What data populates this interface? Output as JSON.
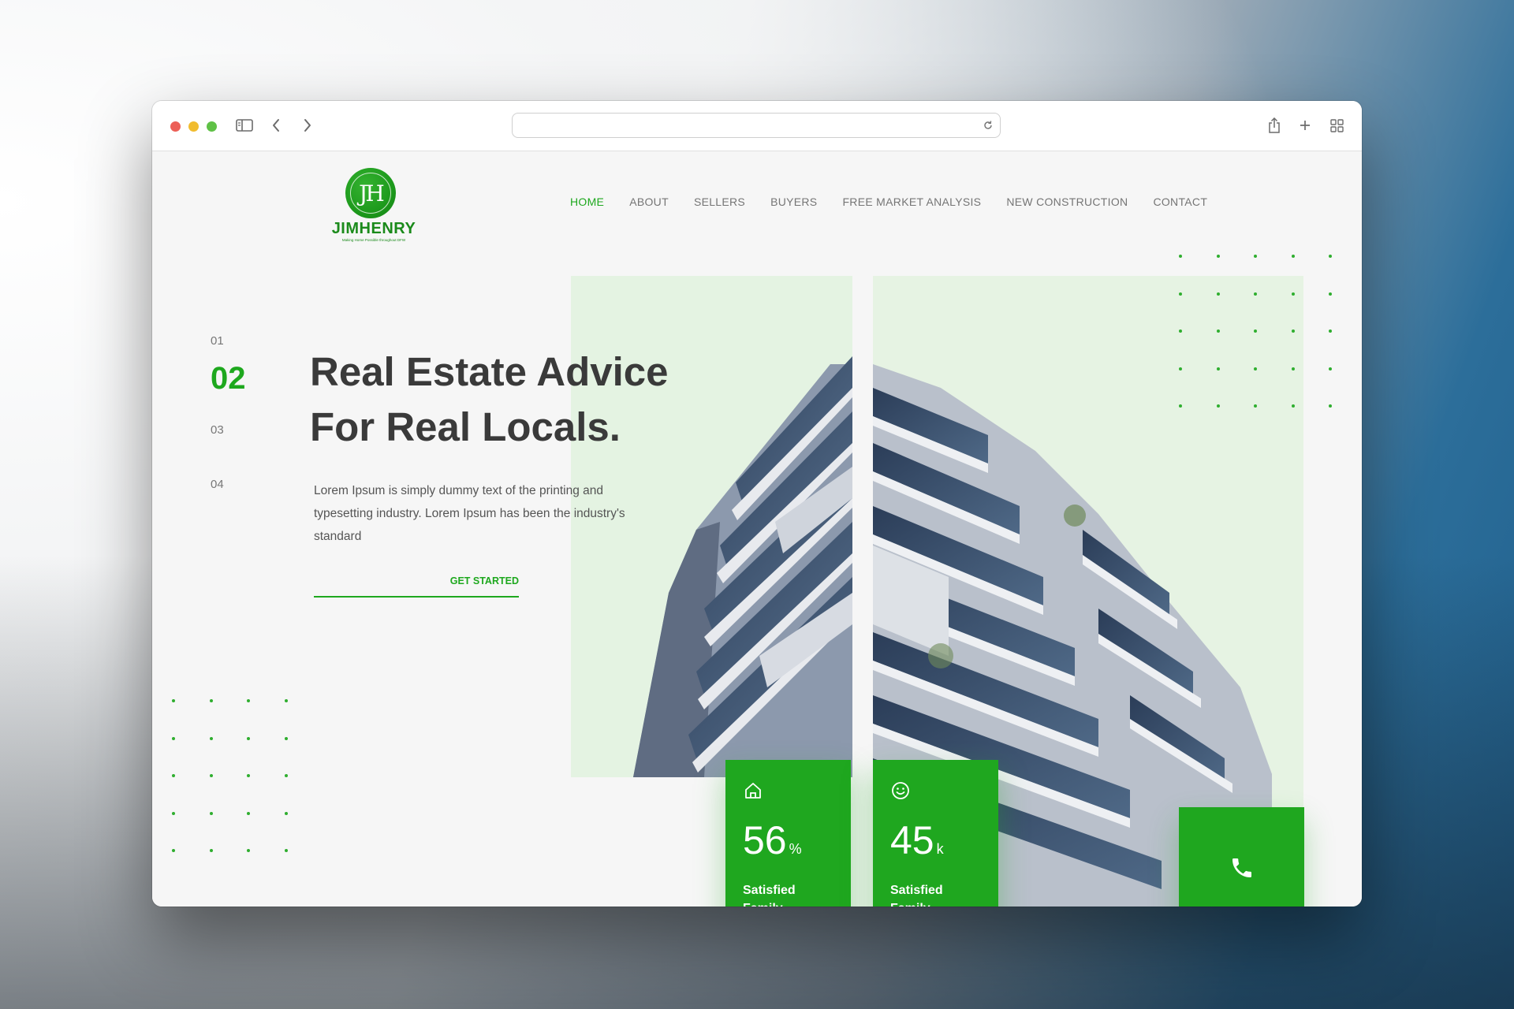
{
  "browser": {
    "url": ""
  },
  "logo": {
    "monogram": "JH",
    "name_first": "JIM",
    "name_last": "HENRY",
    "tagline": "Making Home Possible throughout DFW"
  },
  "nav": {
    "items": [
      {
        "label": "HOME",
        "active": true
      },
      {
        "label": "ABOUT",
        "active": false
      },
      {
        "label": "SELLERS",
        "active": false
      },
      {
        "label": "BUYERS",
        "active": false
      },
      {
        "label": "FREE MARKET ANALYSIS",
        "active": false
      },
      {
        "label": "NEW CONSTRUCTION",
        "active": false
      },
      {
        "label": "CONTACT",
        "active": false
      }
    ]
  },
  "slider": {
    "numbers": [
      "01",
      "02",
      "03",
      "04"
    ],
    "active_index": 1
  },
  "hero": {
    "title_line1": "Real Estate Advice",
    "title_line2": "For Real Locals.",
    "description": "Lorem Ipsum is simply dummy text of the printing and typesetting industry. Lorem Ipsum has been the industry's standard",
    "cta_label": "GET STARTED"
  },
  "stats": [
    {
      "icon": "home-icon",
      "value": "56",
      "unit": "%",
      "label": "Satisfied Family"
    },
    {
      "icon": "smiley-icon",
      "value": "45",
      "unit": "k",
      "label": "Satisfied Family"
    }
  ],
  "call_button": {
    "icon": "phone-icon"
  },
  "colors": {
    "accent": "#1fa71f",
    "accent_pale": "#e4f3e2",
    "heading": "#3a3a3a",
    "text": "#555555"
  }
}
